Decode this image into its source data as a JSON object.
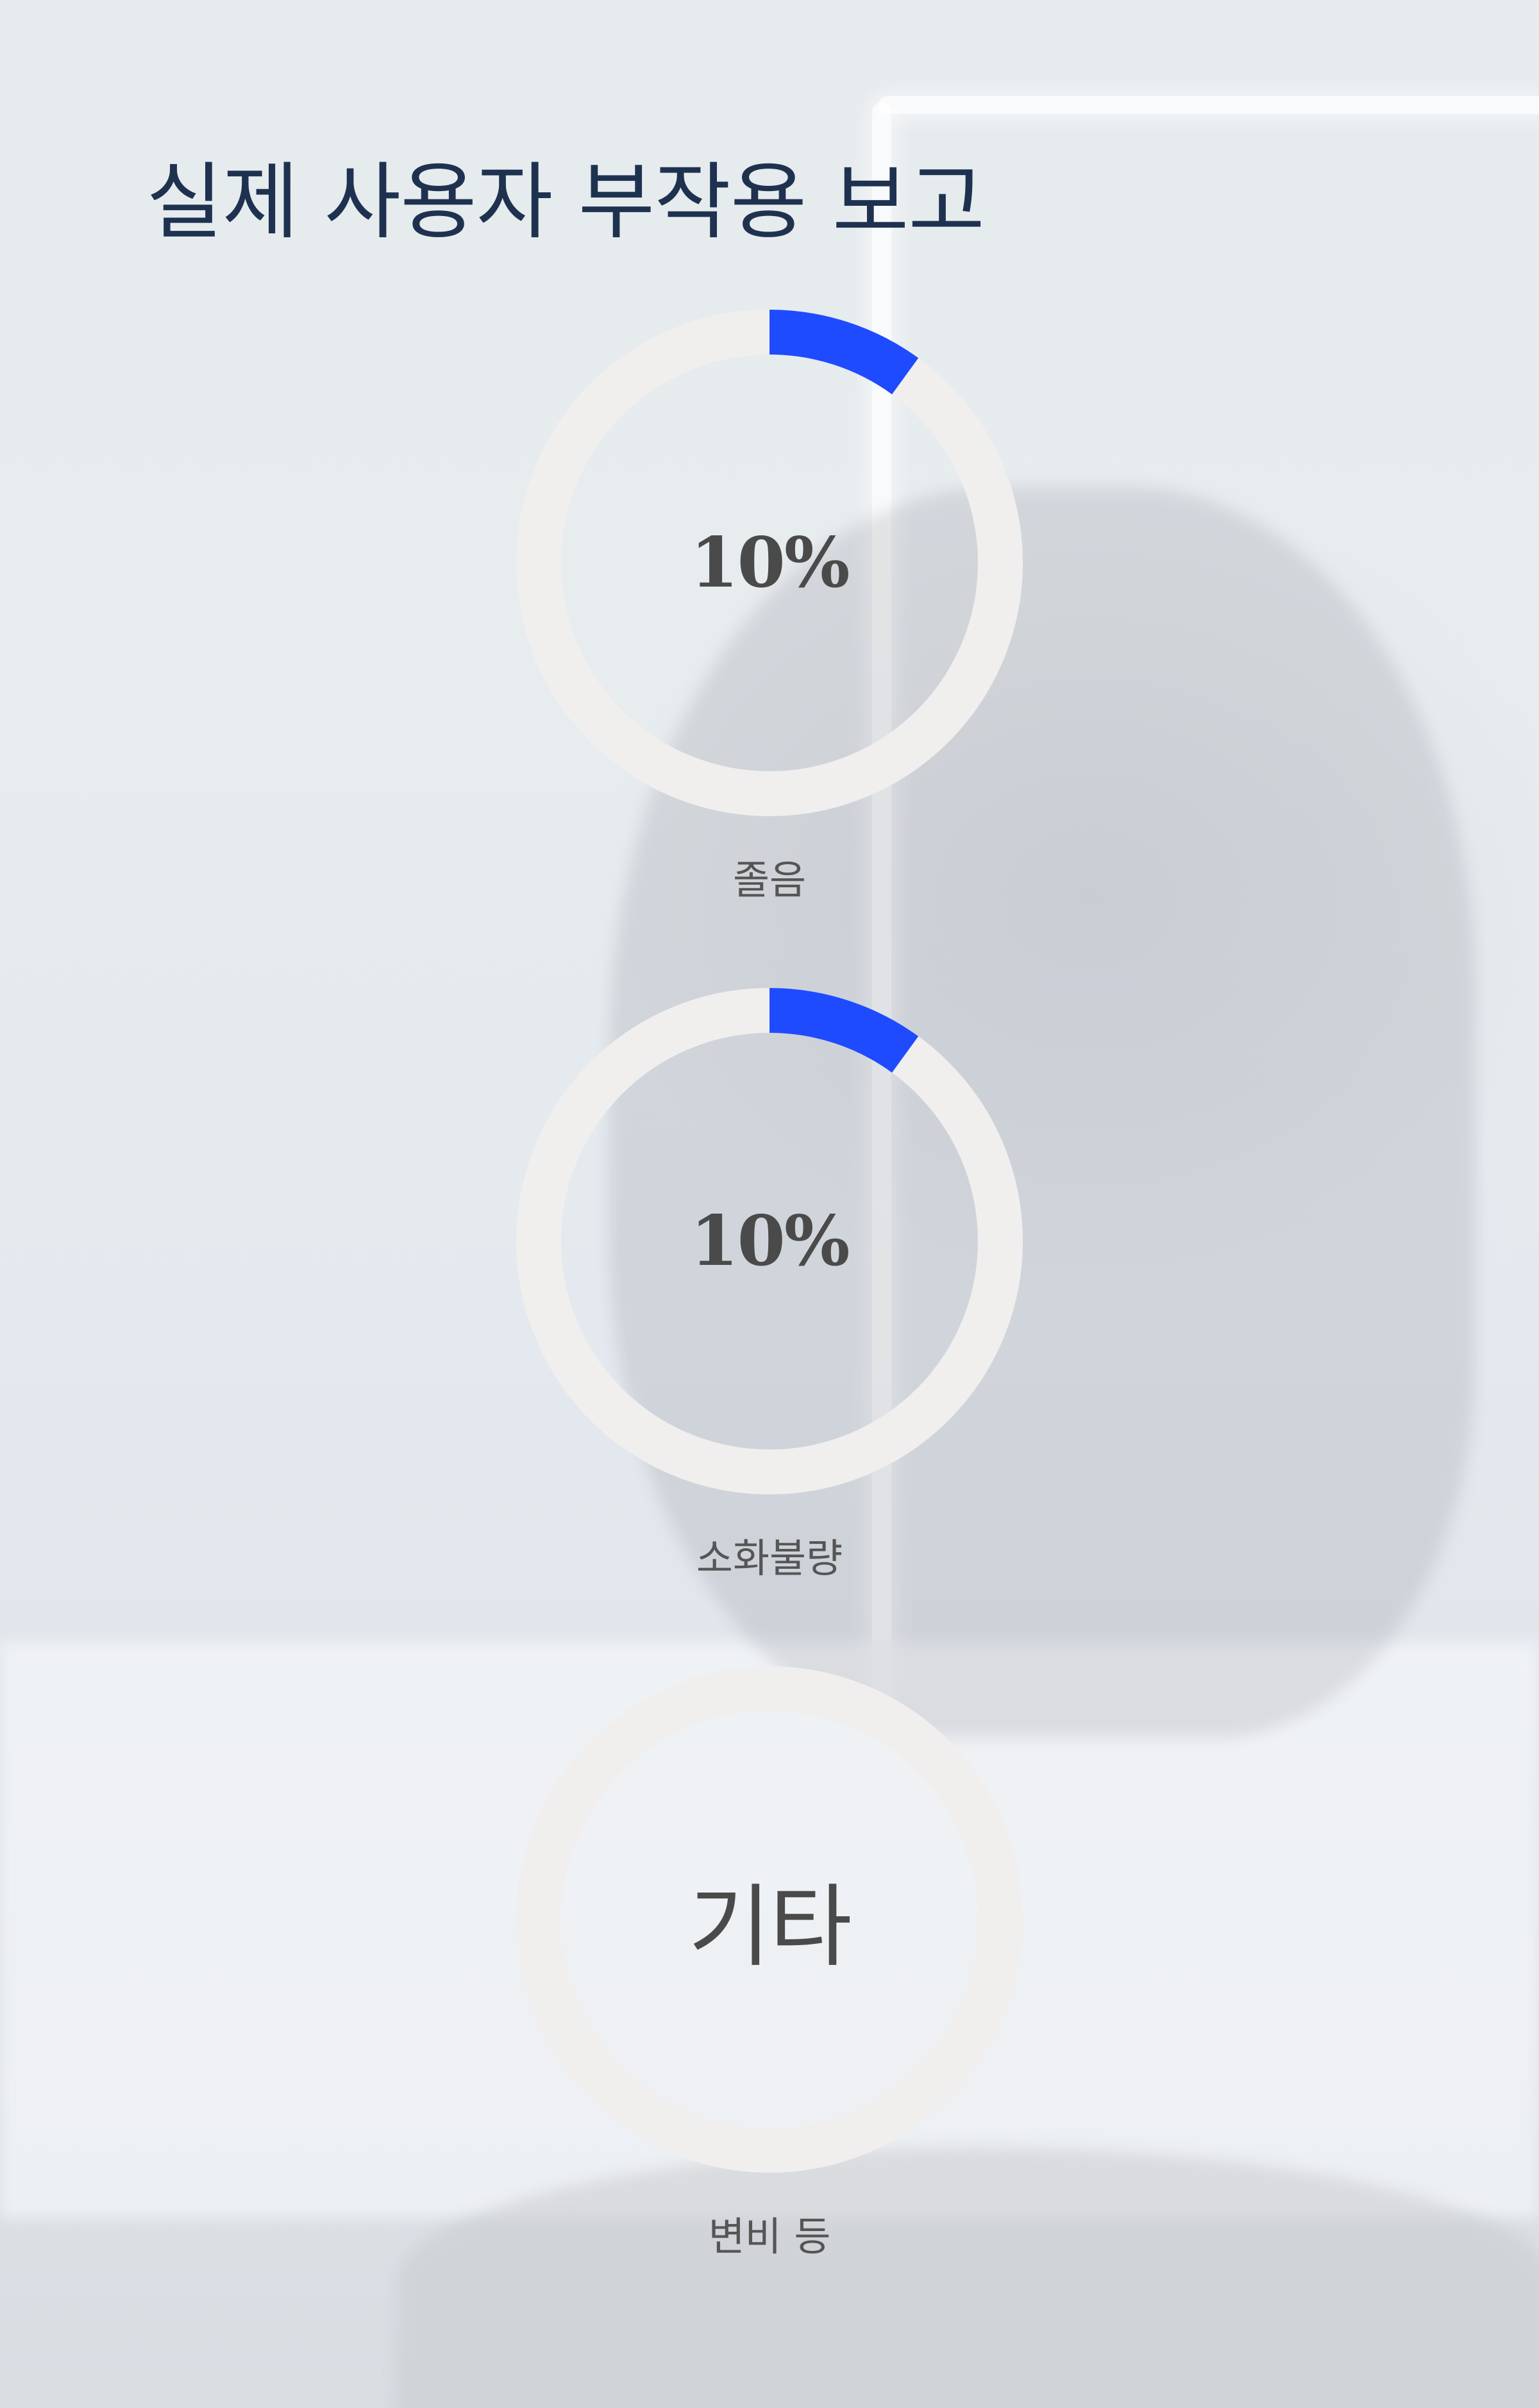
{
  "page": {
    "title": "실제 사용자 부작용 보고"
  },
  "colors": {
    "accent": "#1f4bff",
    "track": "#f1efee",
    "title": "#1e3250",
    "text": "#4a4a4a"
  },
  "stats": [
    {
      "value_text": "10%",
      "value": 0.1,
      "label": "졸음"
    },
    {
      "value_text": "10%",
      "value": 0.1,
      "label": "소화불량"
    },
    {
      "value_text": "기타",
      "label": "변비 등"
    }
  ]
}
